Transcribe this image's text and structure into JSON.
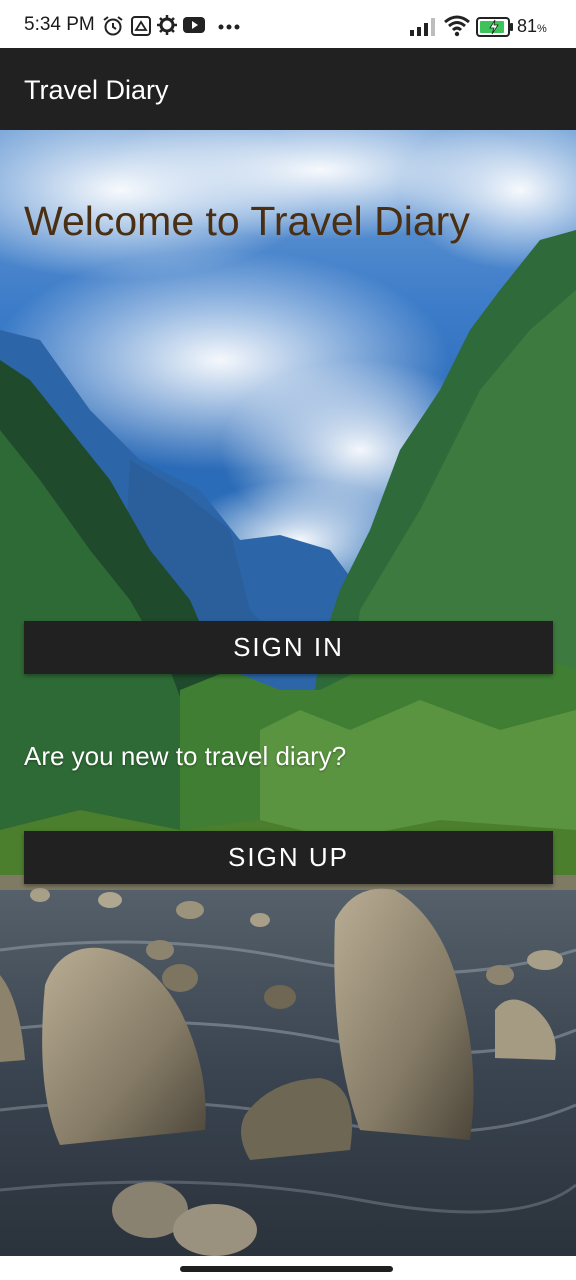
{
  "status_bar": {
    "time": "5:34 PM",
    "battery_percent": "81",
    "battery_unit": "%",
    "icons": [
      "alarm-icon",
      "share-icon",
      "gear-icon",
      "youtube-icon",
      "more-icon",
      "signal-icon",
      "wifi-icon",
      "battery-icon"
    ]
  },
  "app_bar": {
    "title": "Travel Diary"
  },
  "main": {
    "welcome": "Welcome to Travel Diary",
    "sign_in_label": "SIGN IN",
    "question": "Are you new to travel diary?",
    "sign_up_label": "SIGN UP"
  },
  "colors": {
    "app_bar": "#212121",
    "button": "#212121",
    "welcome_text": "#4a2f12",
    "sky": "#3b7bc8",
    "battery_fill": "#3cc45a"
  }
}
